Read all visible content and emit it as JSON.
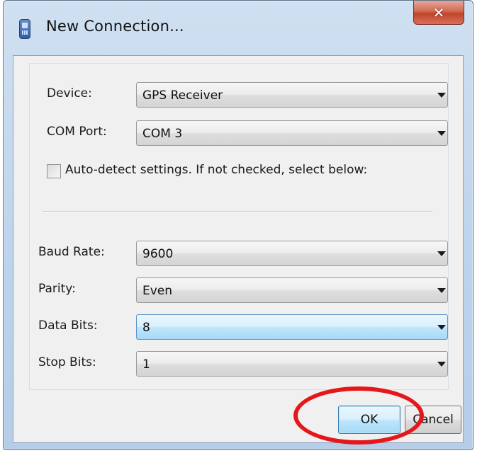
{
  "window": {
    "title": "New Connection...",
    "close_glyph": "✕"
  },
  "fields": {
    "device": {
      "label": "Device:",
      "value": "GPS Receiver"
    },
    "com_port": {
      "label": "COM Port:",
      "value": "COM 3"
    },
    "auto_detect": {
      "label": "Auto-detect settings. If not checked, select below:",
      "checked": false
    },
    "baud_rate": {
      "label": "Baud Rate:",
      "value": "9600"
    },
    "parity": {
      "label": "Parity:",
      "value": "Even"
    },
    "data_bits": {
      "label": "Data Bits:",
      "value": "8"
    },
    "stop_bits": {
      "label": "Stop Bits:",
      "value": "1"
    }
  },
  "buttons": {
    "ok": "OK",
    "cancel": "Cancel"
  },
  "colors": {
    "highlight_ring": "#e5171b",
    "focus_blue": "#5b94c8"
  }
}
